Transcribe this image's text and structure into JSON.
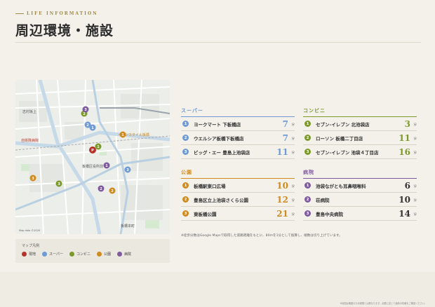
{
  "header": {
    "kicker": "LIFE INFORMATION",
    "title": "周辺環境・施設"
  },
  "colors": {
    "gold": "#a28a45",
    "supermarket": "#6f9ad3",
    "convenience": "#7b9a2a",
    "park": "#d18a1e",
    "hospital": "#7f5aa0",
    "current": "#b5332a"
  },
  "map": {
    "label_1": "イオンスタイル板橋",
    "label_2": "自衛隊病院",
    "label_3": "志村坂上",
    "label_4": "板橋区役所前",
    "label_5": "板橋本町",
    "credit": "Map data ©2026"
  },
  "legend": {
    "title": "マップ凡例",
    "items": [
      {
        "icon": "pin-current-icon",
        "label": "現地"
      },
      {
        "icon": "supermarket-icon",
        "label": "スーパー"
      },
      {
        "icon": "convenience-store-icon",
        "label": "コンビニ"
      },
      {
        "icon": "park-icon",
        "label": "公園"
      },
      {
        "icon": "hospital-icon",
        "label": "病院"
      }
    ]
  },
  "supermarket": {
    "heading": "スーパー",
    "unit": "分",
    "items": [
      {
        "no": "1",
        "name": "ヨークマート 下板橋店",
        "minutes": "7"
      },
      {
        "no": "2",
        "name": "ウエルシア板橋下板橋店",
        "minutes": "7"
      },
      {
        "no": "3",
        "name": "ビッグ・エー 豊島上池袋店",
        "minutes": "11"
      }
    ]
  },
  "convenience": {
    "heading": "コンビニ",
    "unit": "分",
    "items": [
      {
        "no": "1",
        "name": "セブン-イレブン 北池袋店",
        "minutes": "3"
      },
      {
        "no": "2",
        "name": "ローソン 板橋二丁目店",
        "minutes": "11"
      },
      {
        "no": "3",
        "name": "セブン-イレブン 池袋４丁目店",
        "minutes": "16"
      }
    ]
  },
  "park": {
    "heading": "公園",
    "unit": "分",
    "items": [
      {
        "no": "1",
        "name": "板橋駅東口広場",
        "minutes": "10"
      },
      {
        "no": "2",
        "name": "豊島区立上池袋さくら公園",
        "minutes": "12"
      },
      {
        "no": "3",
        "name": "東板橋公園",
        "minutes": "21"
      }
    ]
  },
  "hospital": {
    "heading": "病院",
    "unit": "分",
    "items": [
      {
        "no": "1",
        "name": "池袋ながとも耳鼻咽喉科",
        "minutes": "6"
      },
      {
        "no": "2",
        "name": "荘病院",
        "minutes": "10"
      },
      {
        "no": "3",
        "name": "豊島中央病院",
        "minutes": "14"
      }
    ]
  },
  "note": "※徒歩分数はGoogle Mapsで取得した道路距離をもとに、80mを1分として換算し、端数は切り上げています。",
  "footer_note": "※地図は略図のため実際とは異なります。必要に応じて最新の情報をご確認ください。"
}
